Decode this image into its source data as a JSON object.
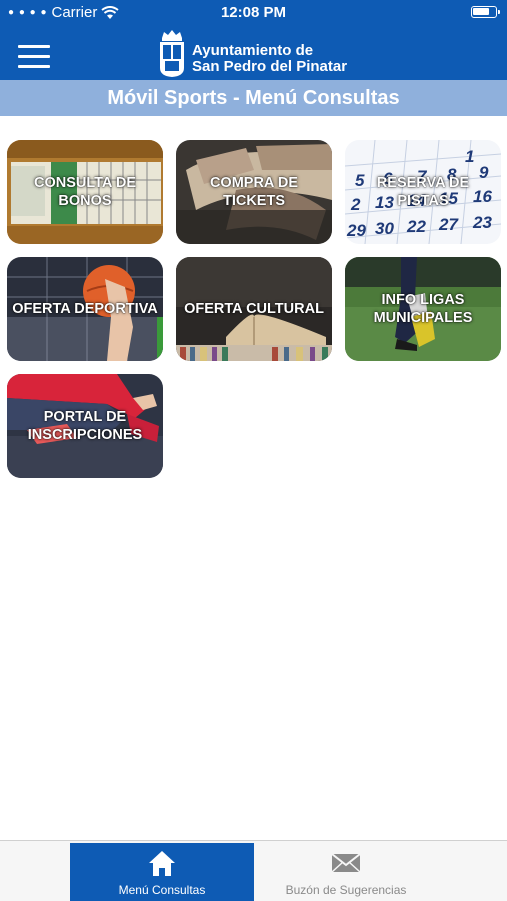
{
  "status_bar": {
    "carrier": "Carrier",
    "time": "12:08 PM"
  },
  "header": {
    "menu_icon": "hamburger-menu-icon",
    "logo_icon": "coat-of-arms-icon",
    "brand_line1": "Ayuntamiento de",
    "brand_line2": "San Pedro del Pinatar"
  },
  "subtitle": "Móvil Sports - Menú Consultas",
  "tiles": [
    {
      "label": "CONSULTA DE\nBONOS"
    },
    {
      "label": "COMPRA DE\nTICKETS"
    },
    {
      "label": "RESERVA DE\nPISTAS"
    },
    {
      "label": "OFERTA DEPORTIVA"
    },
    {
      "label": "OFERTA CULTURAL"
    },
    {
      "label": "INFO LIGAS\nMUNICIPALES"
    },
    {
      "label": "PORTAL DE\nINSCRIPCIONES"
    }
  ],
  "tabbar": {
    "tabs": [
      {
        "label": "Menú Consultas",
        "icon": "home-icon",
        "active": true
      },
      {
        "label": "Buzón de Sugerencias",
        "icon": "envelope-icon",
        "active": false
      }
    ]
  },
  "colors": {
    "brand_blue": "#0e5bb4",
    "subtitle_bar": "#8fb0dc"
  }
}
